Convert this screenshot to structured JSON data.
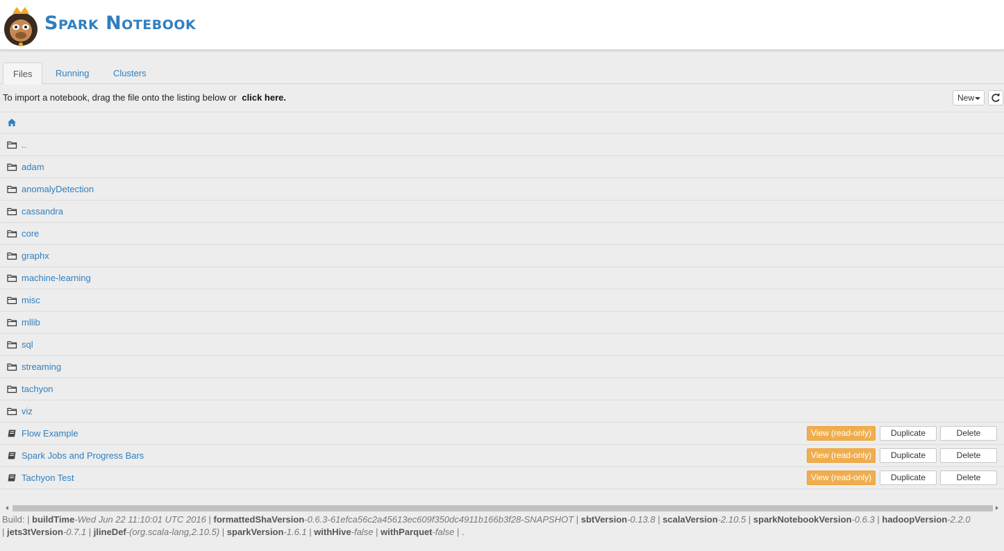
{
  "header": {
    "logo_text": "Spark Notebook"
  },
  "tabs": [
    {
      "label": "Files",
      "active": true
    },
    {
      "label": "Running",
      "active": false
    },
    {
      "label": "Clusters",
      "active": false
    }
  ],
  "import": {
    "text": "To import a notebook, drag the file onto the listing below or",
    "link": "click here.",
    "new_label": "New"
  },
  "folders": [
    "..",
    "adam",
    "anomalyDetection",
    "cassandra",
    "core",
    "graphx",
    "machine-learning",
    "misc",
    "mllib",
    "sql",
    "streaming",
    "tachyon",
    "viz"
  ],
  "notebooks": [
    "Flow Example",
    "Spark Jobs and Progress Bars",
    "Tachyon Test"
  ],
  "notebook_actions": {
    "view": "View (read-only)",
    "duplicate": "Duplicate",
    "delete": "Delete"
  },
  "build": {
    "prefix": "Build: |",
    "items": [
      {
        "key": "buildTime",
        "value": "-Wed Jun 22 11:10:01 UTC 2016"
      },
      {
        "key": "formattedShaVersion",
        "value": "-0.6.3-61efca56c2a45613ec609f350dc4911b166b3f28-SNAPSHOT"
      },
      {
        "key": "sbtVersion",
        "value": "-0.13.8"
      },
      {
        "key": "scalaVersion",
        "value": "-2.10.5"
      },
      {
        "key": "sparkNotebookVersion",
        "value": "-0.6.3"
      },
      {
        "key": "hadoopVersion",
        "value": "-2.2.0"
      },
      {
        "key": "jets3tVersion",
        "value": "-0.7.1"
      },
      {
        "key": "jlineDef",
        "value": "-(org.scala-lang,2.10.5)"
      },
      {
        "key": "sparkVersion",
        "value": "-1.6.1"
      },
      {
        "key": "withHive",
        "value": "-false"
      },
      {
        "key": "withParquet",
        "value": "-false"
      }
    ],
    "suffix": "."
  },
  "colors": {
    "link": "#2f7fc0",
    "view_button": "#f0ad4e",
    "background": "#ededed"
  },
  "icons": {
    "home": "home-icon",
    "folder": "folder-icon",
    "notebook": "notebook-icon",
    "refresh": "refresh-icon"
  }
}
